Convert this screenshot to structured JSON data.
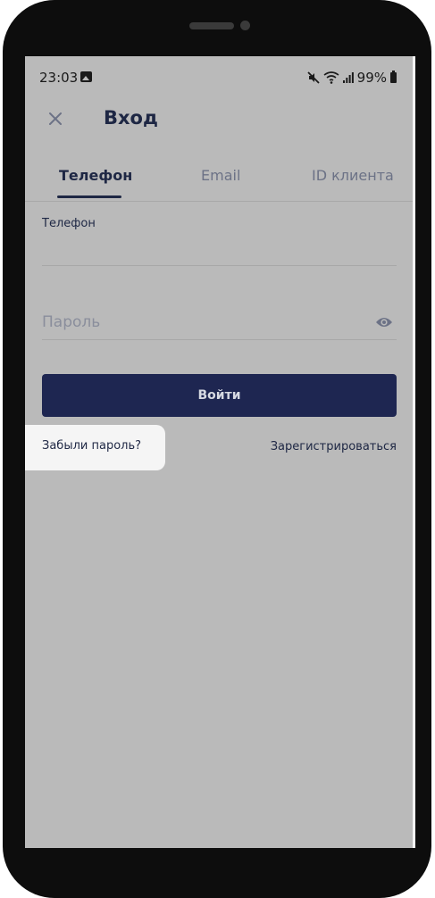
{
  "status_bar": {
    "time": "23:03",
    "battery": "99%"
  },
  "header": {
    "title": "Вход"
  },
  "tabs": [
    {
      "label": "Телефон",
      "active": true
    },
    {
      "label": "Email",
      "active": false
    },
    {
      "label": "ID клиента",
      "active": false
    }
  ],
  "form": {
    "phone_label": "Телефон",
    "phone_value": "",
    "password_placeholder": "Пароль",
    "password_value": "",
    "login_label": "Войти",
    "forgot_label": "Забыли пароль?",
    "register_label": "Зарегистрироваться"
  },
  "icons": {
    "close": "close-icon",
    "eye": "eye-icon",
    "gallery": "gallery-icon",
    "mute": "mute-icon",
    "wifi": "wifi-icon",
    "signal": "signal-icon",
    "battery": "battery-icon"
  },
  "colors": {
    "primary": "#1e2651",
    "text": "#1e2744",
    "muted": "#6c7286",
    "overlay": "#bababa"
  }
}
